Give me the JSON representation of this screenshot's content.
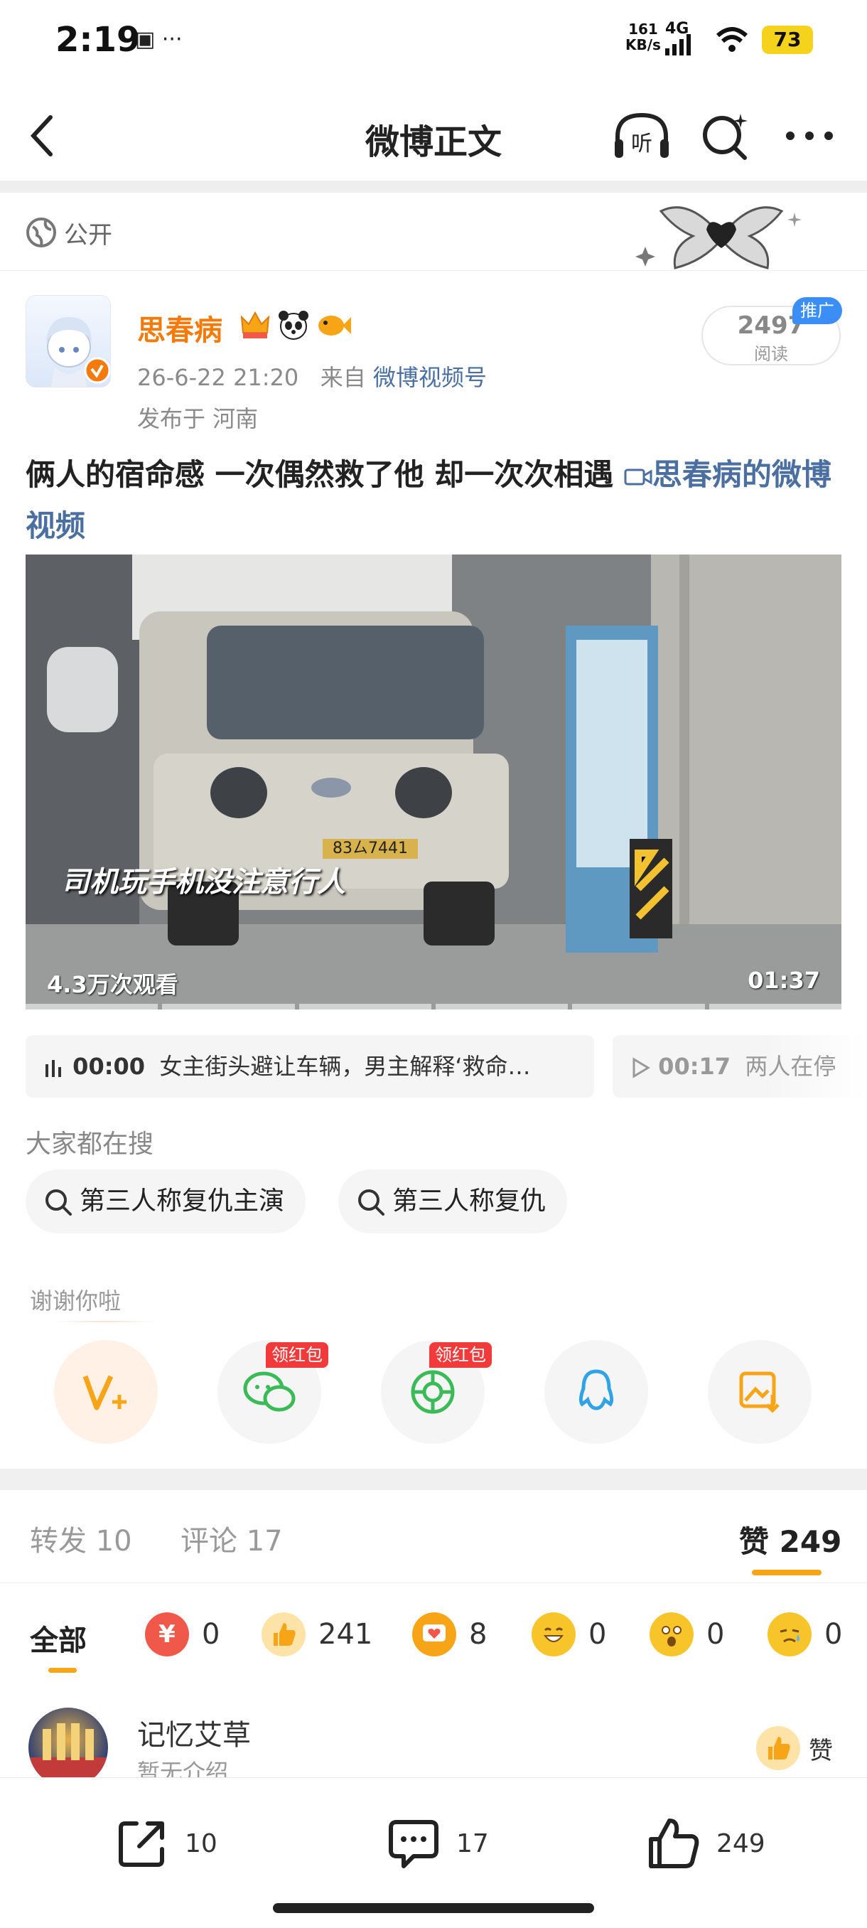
{
  "status_bar": {
    "time": "2:19",
    "extra_icons": "▣ ···",
    "net_speed": "161",
    "net_unit": "KB/s",
    "network": "4G",
    "battery": "73"
  },
  "nav": {
    "title": "微博正文",
    "listen_label": "听"
  },
  "visibility": {
    "label": "公开"
  },
  "author": {
    "name": "思春病",
    "date": "26-6-22 21:20",
    "via": "来自",
    "source": "微博视频号",
    "location": "发布于 河南"
  },
  "reads": {
    "count": "2497",
    "label": "阅读",
    "promo": "推广"
  },
  "post": {
    "text": "俩人的宿命感 一次偶然救了他 却一次次相遇 ",
    "video_link": "思春病的微博视频"
  },
  "video": {
    "caption": "司机玩手机没注意行人",
    "views": "4.3万次观看",
    "duration": "01:37",
    "plate": "83ㄙ7441"
  },
  "chapters": [
    {
      "time": "00:00",
      "title": "女主街头避让车辆，男主解释‘救命…"
    },
    {
      "time": "00:17",
      "title": "两人在停"
    }
  ],
  "search": {
    "heading": "大家都在搜",
    "items": [
      "第三人称复仇主演",
      "第三人称复仇"
    ]
  },
  "share": {
    "thanks": "谢谢你啦",
    "red_packet_label": "领红包"
  },
  "tabs": {
    "reposts_label": "转发",
    "reposts_count": "10",
    "comments_label": "评论",
    "comments_count": "17",
    "likes_label": "赞",
    "likes_count": "249"
  },
  "reactions": {
    "all_label": "全部",
    "items": [
      {
        "name": "yuan-icon",
        "count": "0",
        "color": "#f0584a"
      },
      {
        "name": "thumbs-up-icon",
        "count": "241",
        "color": "#f7b733"
      },
      {
        "name": "heart-bubble-icon",
        "count": "8",
        "color": "#f7a516"
      },
      {
        "name": "laugh-icon",
        "count": "0",
        "color": "#f7c52a"
      },
      {
        "name": "surprised-icon",
        "count": "0",
        "color": "#f7c52a"
      },
      {
        "name": "sad-icon",
        "count": "0",
        "color": "#f7c52a"
      }
    ]
  },
  "liker": {
    "name": "记忆艾草",
    "intro": "暂无介绍",
    "like_label": "赞"
  },
  "bottom_bar": {
    "repost_count": "10",
    "comment_count": "17",
    "like_count": "249"
  },
  "colors": {
    "accent": "#f7a516",
    "name_orange": "#f57a0c",
    "link_blue": "#4a6fa0",
    "red_tag": "#f23a3a"
  }
}
